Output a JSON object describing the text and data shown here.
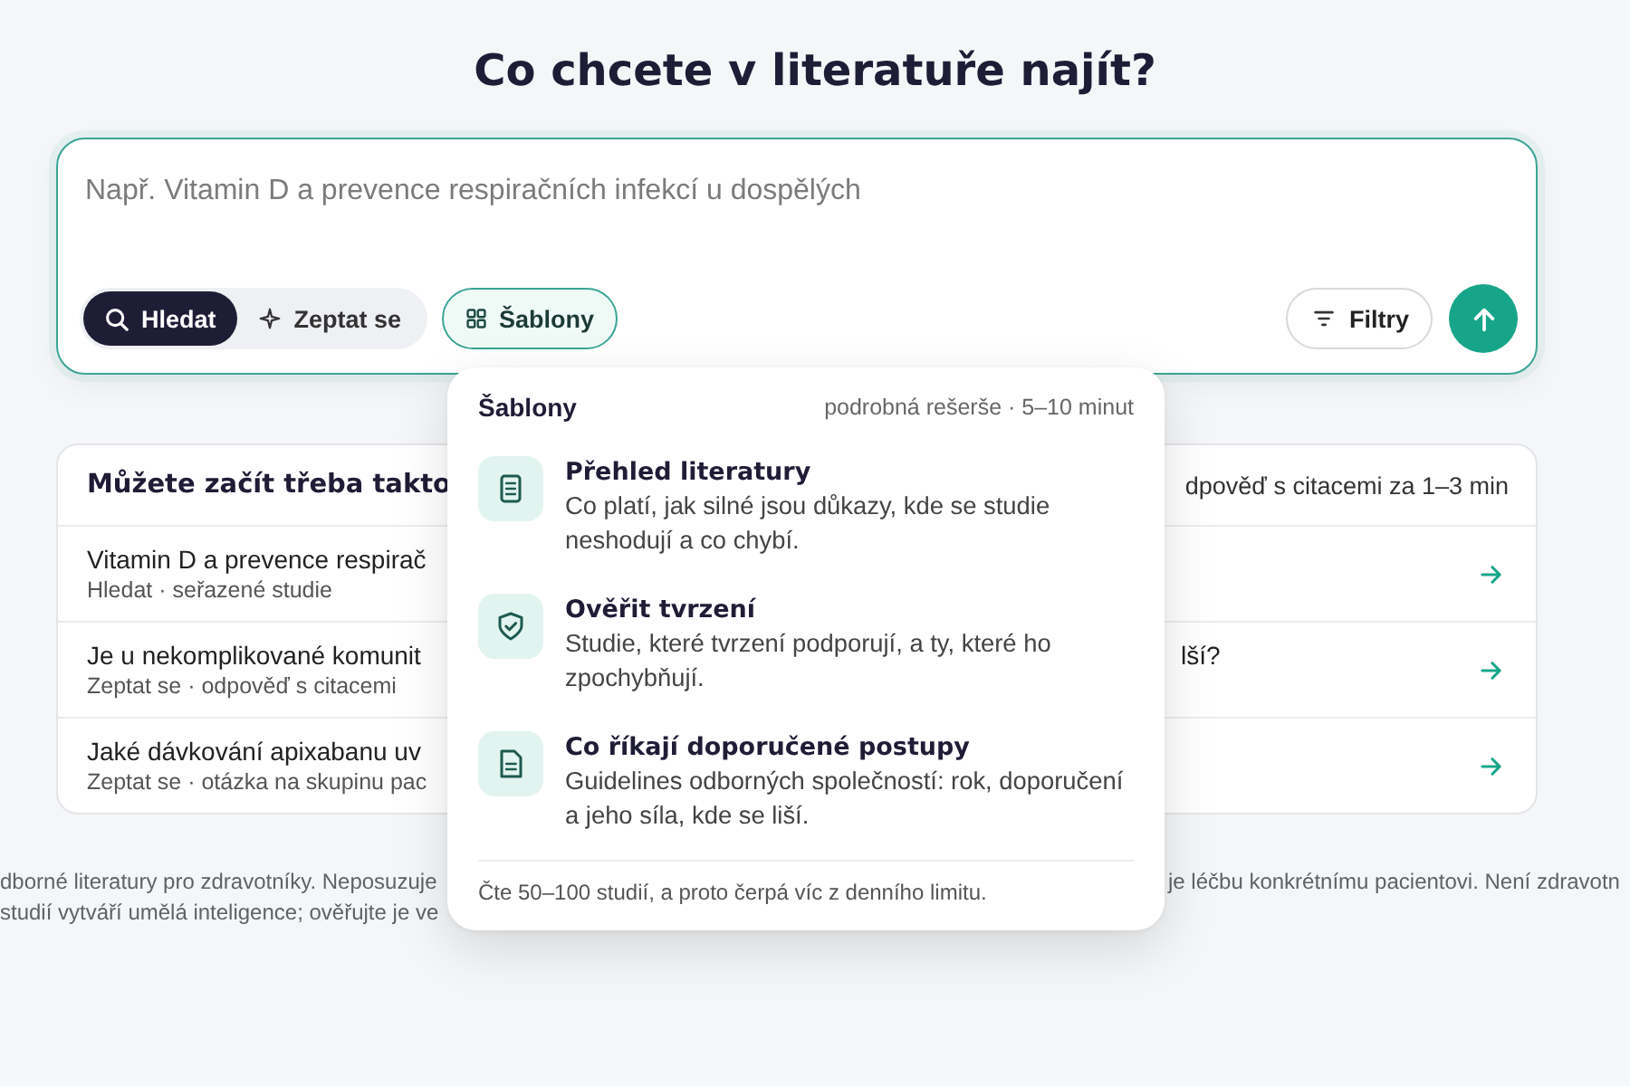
{
  "heading": "Co chcete v literatuře najít?",
  "search": {
    "placeholder": "Např. Vitamin D a prevence respiračních infekcí u dospělých",
    "modes": [
      {
        "kind": "search",
        "label": "Hledat",
        "selected": true
      },
      {
        "kind": "ask",
        "label": "Zeptat se",
        "selected": false
      }
    ],
    "templates_button": {
      "label": "Šablony",
      "expanded": true
    },
    "filters_button": {
      "label": "Filtry"
    }
  },
  "templates_menu": {
    "title": "Šablony",
    "note": "podrobná rešerše · 5–10 minut",
    "items": [
      {
        "kind": "review",
        "title": "Přehled literatury",
        "description": "Co platí, jak silné jsou důkazy, kde se studie neshodují a co chybí."
      },
      {
        "kind": "verify",
        "title": "Ověřit tvrzení",
        "description": "Studie, které tvrzení podporují, a ty, které ho zpochybňují."
      },
      {
        "kind": "guidelines",
        "title": "Co říkají doporučené postupy",
        "description": "Guidelines odborných společností: rok, doporučení a jeho síla, kde se liší."
      }
    ],
    "footer": "Čte 50–100 studií, a proto čerpá víc z denního limitu."
  },
  "suggestions": {
    "title": "Můžete začít třeba takto",
    "note": "dpověď s citacemi za 1–3 min",
    "rows": [
      {
        "title": "Vitamin D a prevence respirač",
        "subtitle": "Hledat · seřazené studie"
      },
      {
        "title": "Je u nekomplikované komunit",
        "title_end": "lší?",
        "subtitle": "Zeptat se · odpověď s citacemi"
      },
      {
        "title": "Jaké dávkování apixabanu uv",
        "subtitle": "Zeptat se · otázka na skupinu pac"
      }
    ]
  },
  "disclaimer": {
    "lines": [
      {
        "left": "dborné literatury pro zdravotníky. Neposuzuje",
        "right": "je léčbu konkrétnímu pacientovi. Není zdravotn"
      },
      {
        "left": "studií vytváří umělá inteligence; ověřujte je ve"
      }
    ]
  }
}
